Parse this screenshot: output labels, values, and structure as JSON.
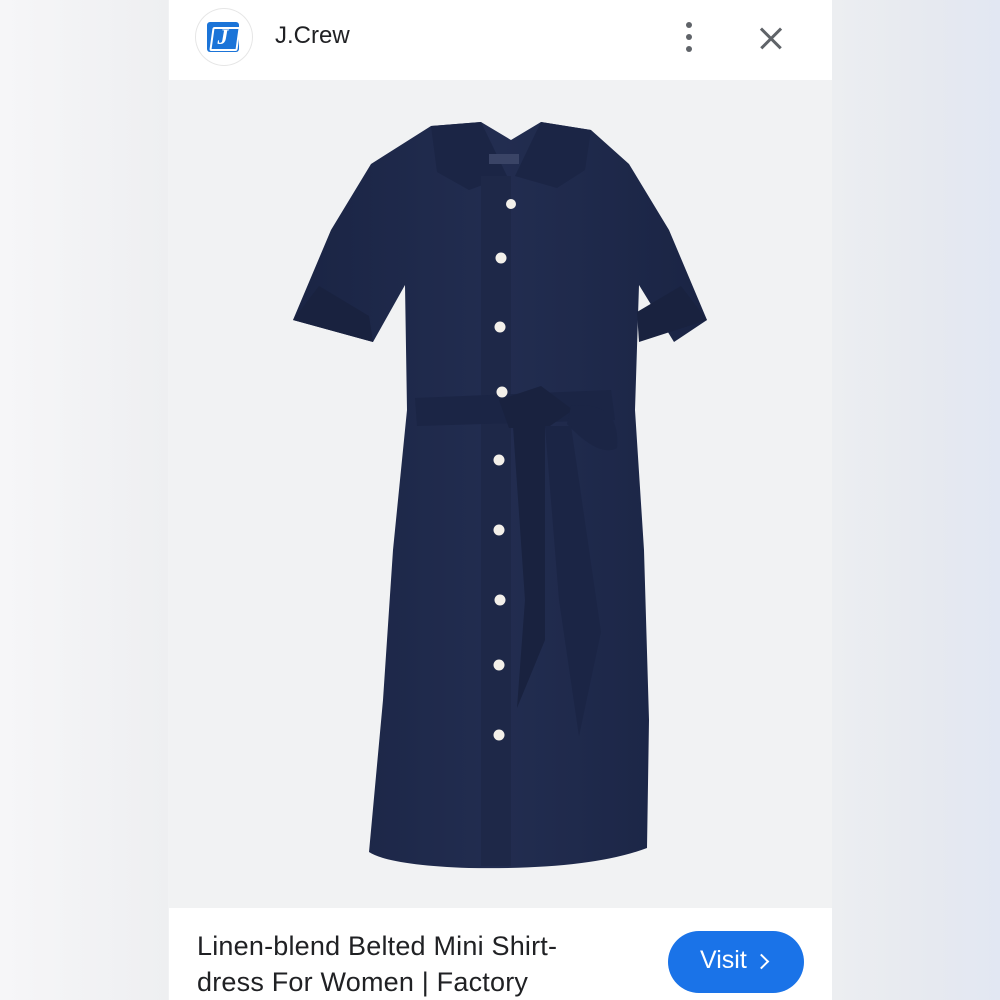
{
  "header": {
    "logo_letter": "J",
    "brand_name": "J.Crew",
    "more_icon": "more-vertical-icon",
    "close_icon": "close-icon"
  },
  "product_image": {
    "color": "#1f2a4a",
    "button_color": "#f3f0ea"
  },
  "footer": {
    "title": "Linen-blend Belted Mini Shirt-dress For Women | Factory",
    "visit_label": "Visit",
    "visit_icon": "chevron-right-icon"
  },
  "colors": {
    "accent": "#1a73e8",
    "logo_blue": "#1b74d8"
  }
}
